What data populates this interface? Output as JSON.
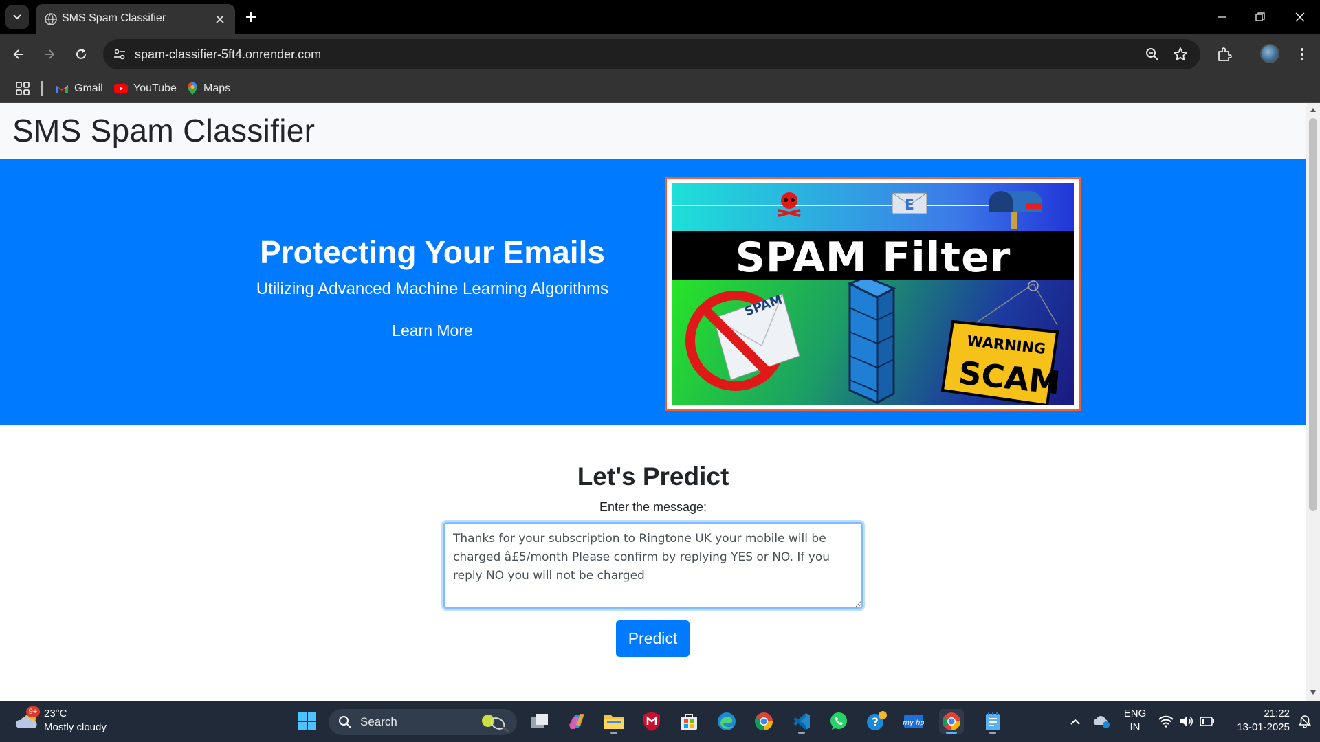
{
  "browser": {
    "tab_title": "SMS Spam Classifier",
    "url": "spam-classifier-5ft4.onrender.com",
    "bookmarks": [
      {
        "label": "Gmail",
        "icon": "gmail-icon"
      },
      {
        "label": "YouTube",
        "icon": "youtube-icon"
      },
      {
        "label": "Maps",
        "icon": "maps-icon"
      }
    ]
  },
  "page": {
    "site_title": "SMS Spam Classifier",
    "hero": {
      "title": "Protecting Your Emails",
      "subtitle": "Utilizing Advanced Machine Learning Algorithms",
      "link": "Learn More",
      "banner": {
        "heading": "SPAM Filter",
        "envelope_label": "SPAM",
        "envelope_letter": "E",
        "warning_label": "WARNING",
        "scam_label": "SCAM"
      }
    },
    "predict": {
      "title": "Let's Predict",
      "label": "Enter the message:",
      "message": "Thanks for your subscription to Ringtone UK your mobile will be charged â£5/month Please confirm by replying YES or NO. If you reply NO you will not be charged",
      "button": "Predict"
    }
  },
  "taskbar": {
    "weather_badge": "9+",
    "temperature": "23°C",
    "weather": "Mostly cloudy",
    "search_placeholder": "Search",
    "language": "ENG",
    "region": "IN",
    "time": "21:22",
    "date": "13-01-2025"
  },
  "colors": {
    "hero_bg": "#007bff",
    "button_bg": "#007bff",
    "header_bg": "#f8f9fa",
    "browser_bg": "#333333",
    "taskbar_bg": "#202a38"
  }
}
